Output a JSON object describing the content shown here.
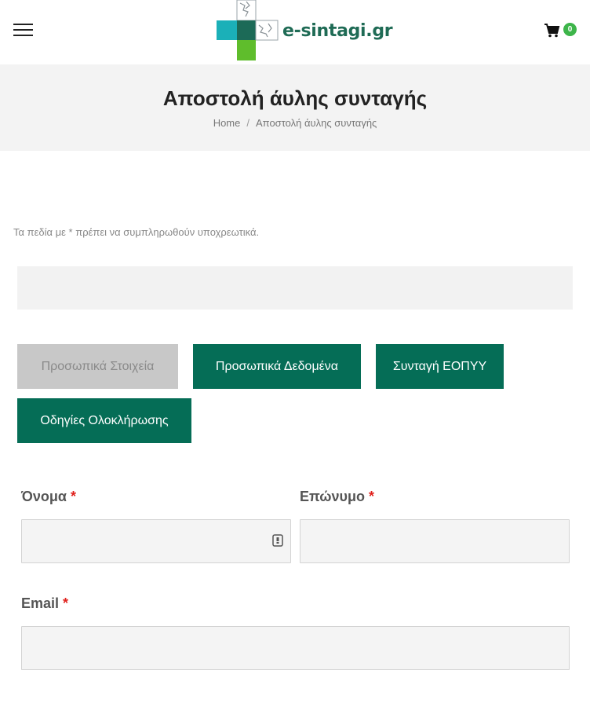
{
  "header": {
    "logo_text": "e-sintagi.gr",
    "cart_count": "0"
  },
  "title_band": {
    "title": "Αποστολή άυλης συνταγής",
    "breadcrumb_home": "Home",
    "breadcrumb_separator": "/",
    "breadcrumb_current": "Αποστολή άυλης συνταγής"
  },
  "form": {
    "required_note": "Τα πεδία με * πρέπει να συμπληρωθούν υποχρεωτικά.",
    "steps": [
      {
        "label": "Προσωπικά Στοιχεία",
        "active": false
      },
      {
        "label": "Προσωπικά Δεδομένα",
        "active": true
      },
      {
        "label": "Συνταγή ΕΟΠΥΥ",
        "active": true
      },
      {
        "label": "Οδηγίες Ολοκλήρωσης",
        "active": true
      }
    ],
    "first_name_label": "Όνομα",
    "last_name_label": "Επώνυμο",
    "email_label": "Email",
    "required_star": "*",
    "first_name_value": "",
    "last_name_value": "",
    "email_value": ""
  },
  "colors": {
    "accent": "#056d56",
    "inactive_tab": "#c8c8c8",
    "badge": "#3db54a",
    "required": "#e0201b"
  }
}
